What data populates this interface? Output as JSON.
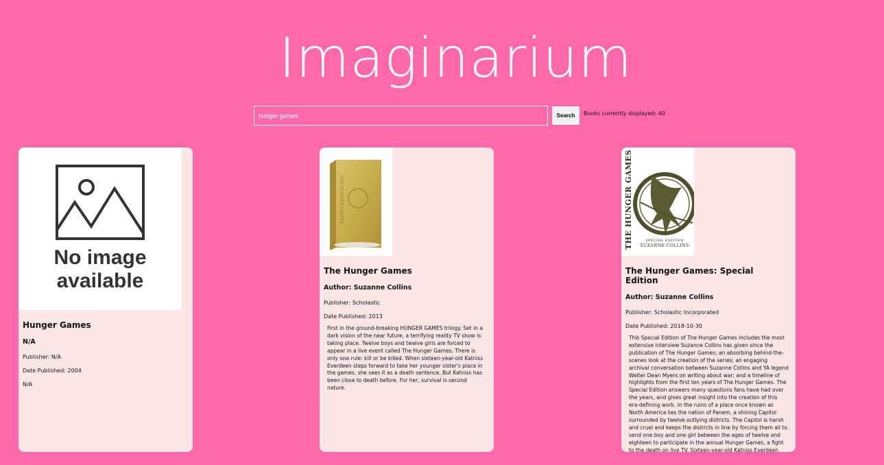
{
  "app": {
    "title": "Imaginarium"
  },
  "search": {
    "value": "hunger games",
    "button_label": "Search",
    "count_text": "Books currently displayed: 40"
  },
  "placeholder_image": {
    "line1": "No image",
    "line2": "available"
  },
  "books": [
    {
      "title": "Hunger Games",
      "author": "N/A",
      "publisher": "Publisher: N/A",
      "date": "Date Published: 2004",
      "description": "N/A",
      "cover": "no-image-placeholder"
    },
    {
      "title": "The Hunger Games",
      "author": "Author: Suzanne Collins",
      "publisher": "Publisher: Scholastic",
      "date": "Date Published: 2013",
      "description": "First in the ground-breaking HUNGER GAMES trilogy. Set in a dark vision of the near future, a terrifying reality TV show is taking place. Twelve boys and twelve girls are forced to appear in a live event called The Hunger Games. There is only one rule: kill or be killed. When sixteen-year-old Katniss Everdeen steps forward to take her younger sister's place in the games, she sees it as a death sentence. But Katniss has been close to death before. For her, survival is second nature.",
      "cover": "gold-book-cover"
    },
    {
      "title": "The Hunger Games: Special Edition",
      "author": "Author: Suzanne Collins",
      "publisher": "Publisher: Scholastic Incorporated",
      "date": "Date Published: 2018-10-30",
      "description": "This Special Edition of The Hunger Games includes the most extensive interview Suzanne Collins has given since the publication of The Hunger Games; an absorbing behind-the-scenes look at the creation of the series; an engaging archival conversation between Suzanne Collins and YA legend Walter Dean Myers on writing about war; and a timeline of highlights from the first ten years of The Hunger Games. The Special Edition answers many questions fans have had over the years, and gives great insight into the creation of this era-defining work. In the ruins of a place once known as North America lies the nation of Panem, a shining Capitol surrounded by twelve outlying districts. The Capitol is harsh and cruel and keeps the districts in line by forcing them all to send one boy and one girl between the ages of twelve and eighteen to participate in the annual Hunger Games, a fight to the death on live TV. Sixteen-year-old Katniss Everdeen regards it as a dea",
      "cover": "mockingjay-special-edition-cover",
      "cover_text": {
        "spine_title": "THE HUNGER GAMES",
        "edition": "SPECIAL EDITION",
        "author": "SUZANNE COLLINS"
      }
    }
  ],
  "colors": {
    "background": "#ff69a9",
    "card": "#fde6e6",
    "title": "#ffffff"
  }
}
